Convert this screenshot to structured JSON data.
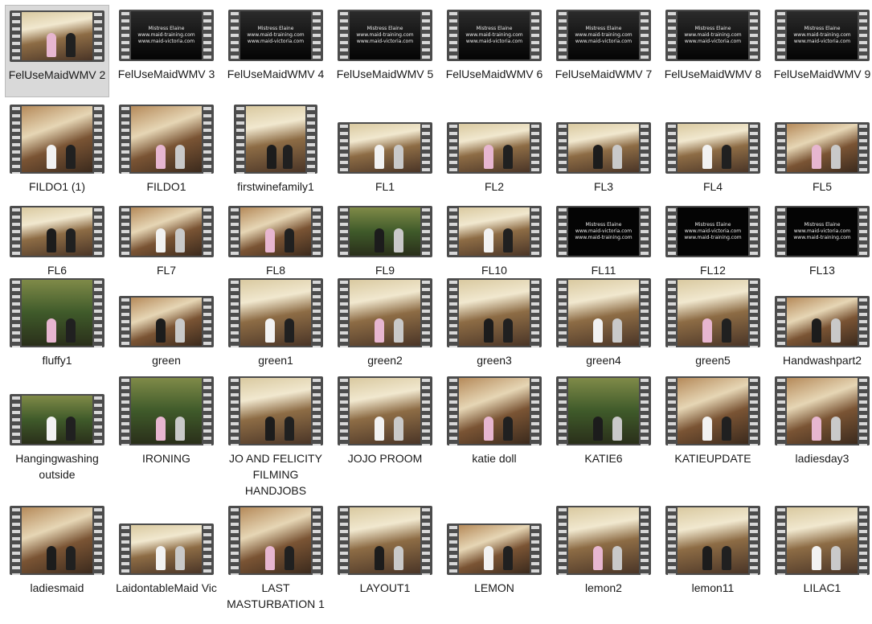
{
  "items": [
    {
      "label": "FelUseMaidWMV 2",
      "thumb": "room",
      "selected": true
    },
    {
      "label": "FelUseMaidWMV 3",
      "thumb": "dark",
      "text1": "Mistress Elaine",
      "text2": "www.maid-training.com",
      "text3": "www.maid-victoria.com"
    },
    {
      "label": "FelUseMaidWMV 4",
      "thumb": "dark",
      "text1": "Mistress Elaine",
      "text2": "www.maid-training.com",
      "text3": "www.maid-victoria.com"
    },
    {
      "label": "FelUseMaidWMV 5",
      "thumb": "dark",
      "text1": "Mistress Elaine",
      "text2": "www.maid-training.com",
      "text3": "www.maid-victoria.com"
    },
    {
      "label": "FelUseMaidWMV 6",
      "thumb": "dark",
      "text1": "Mistress Elaine",
      "text2": "www.maid-training.com",
      "text3": "www.maid-victoria.com"
    },
    {
      "label": "FelUseMaidWMV 7",
      "thumb": "dark",
      "text1": "Mistress Elaine",
      "text2": "www.maid-training.com",
      "text3": "www.maid-victoria.com"
    },
    {
      "label": "FelUseMaidWMV 8",
      "thumb": "dark",
      "text1": "Mistress Elaine",
      "text2": "www.maid-training.com",
      "text3": "www.maid-victoria.com"
    },
    {
      "label": "FelUseMaidWMV 9",
      "thumb": "dark",
      "text1": "Mistress Elaine",
      "text2": "www.maid-training.com",
      "text3": "www.maid-victoria.com"
    },
    {
      "label": "FILDO1 (1)",
      "thumb": "photo"
    },
    {
      "label": "FILDO1",
      "thumb": "photo"
    },
    {
      "label": "firstwinefamily1",
      "thumb": "room"
    },
    {
      "label": "FL1",
      "thumb": "room"
    },
    {
      "label": "FL2",
      "thumb": "room"
    },
    {
      "label": "FL3",
      "thumb": "room"
    },
    {
      "label": "FL4",
      "thumb": "room"
    },
    {
      "label": "FL5",
      "thumb": "photo"
    },
    {
      "label": "FL6",
      "thumb": "room"
    },
    {
      "label": "FL7",
      "thumb": "photo"
    },
    {
      "label": "FL8",
      "thumb": "photo"
    },
    {
      "label": "FL9",
      "thumb": "green"
    },
    {
      "label": "FL10",
      "thumb": "room"
    },
    {
      "label": "FL11",
      "thumb": "black",
      "text1": "Mistress Elaine",
      "text2": "www.maid-victoria.com",
      "text3": "www.maid-training.com"
    },
    {
      "label": "FL12",
      "thumb": "black",
      "text1": "Mistress Elaine",
      "text2": "www.maid-victoria.com",
      "text3": "www.maid-training.com"
    },
    {
      "label": "FL13",
      "thumb": "black",
      "text1": "Mistress Elaine",
      "text2": "www.maid-victoria.com",
      "text3": "www.maid-training.com"
    },
    {
      "label": "fluffy1",
      "thumb": "green"
    },
    {
      "label": "green",
      "thumb": "photo"
    },
    {
      "label": "green1",
      "thumb": "room"
    },
    {
      "label": "green2",
      "thumb": "room"
    },
    {
      "label": "green3",
      "thumb": "room"
    },
    {
      "label": "green4",
      "thumb": "room"
    },
    {
      "label": "green5",
      "thumb": "room"
    },
    {
      "label": "Handwashpart2",
      "thumb": "photo"
    },
    {
      "label": "Hangingwashing outside",
      "thumb": "green"
    },
    {
      "label": "IRONING",
      "thumb": "green"
    },
    {
      "label": "JO AND FELICITY FILMING HANDJOBS",
      "thumb": "room"
    },
    {
      "label": "JOJO PROOM",
      "thumb": "room"
    },
    {
      "label": "katie doll",
      "thumb": "photo"
    },
    {
      "label": "KATIE6",
      "thumb": "green"
    },
    {
      "label": "KATIEUPDATE",
      "thumb": "photo"
    },
    {
      "label": "ladiesday3",
      "thumb": "photo"
    },
    {
      "label": "ladiesmaid",
      "thumb": "photo"
    },
    {
      "label": "LaidontableMaid Vic",
      "thumb": "room"
    },
    {
      "label": "LAST MASTURBATION 1",
      "thumb": "photo"
    },
    {
      "label": "LAYOUT1",
      "thumb": "room"
    },
    {
      "label": "LEMON",
      "thumb": "photo"
    },
    {
      "label": "lemon2",
      "thumb": "room"
    },
    {
      "label": "lemon11",
      "thumb": "room"
    },
    {
      "label": "LILAC1",
      "thumb": "room"
    }
  ]
}
